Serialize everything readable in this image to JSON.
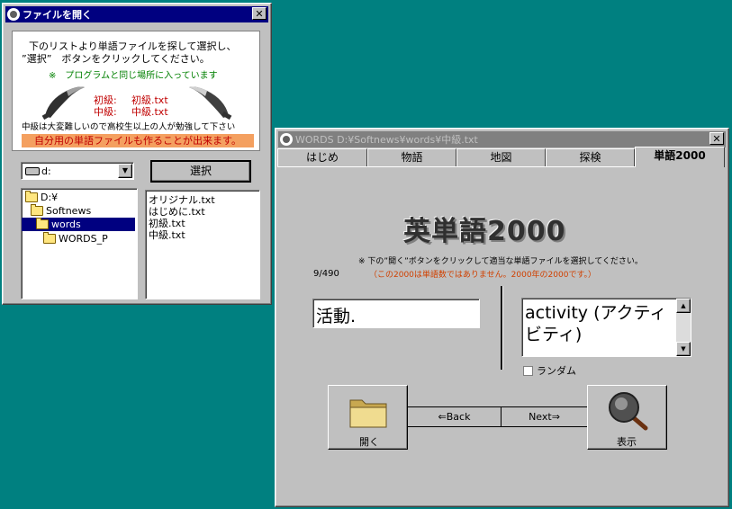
{
  "file_dialog": {
    "title": "ファイルを開く",
    "intro_line1": "下のリストより単語ファイルを探して選択し、",
    "intro_line2": "”選択”　ボタンをクリックしてください。",
    "note": "※　プログラムと同じ場所に入っています",
    "level_beginner_label": "初級:",
    "level_beginner_file": "初級.txt",
    "level_intermediate_label": "中級:",
    "level_intermediate_file": "中級.txt",
    "warning": "中級は大変難しいので高校生以上の人が勉強して下さい",
    "tip": "自分用の単語ファイルも作ることが出来ます。",
    "drive_value": "d:",
    "select_button": "選択",
    "tree": [
      "D:¥",
      "Softnews",
      "words",
      "WORDS_P"
    ],
    "files": [
      "オリジナル.txt",
      "はじめに.txt",
      "初級.txt",
      "中級.txt"
    ]
  },
  "main_window": {
    "title": "WORDS  D:¥Softnews¥words¥中級.txt",
    "tabs": [
      "はじめ",
      "物語",
      "地図",
      "探検",
      "単語2000"
    ],
    "logo": "英単語2000",
    "instruction": "※ 下の”開く”ボタンをクリックして適当な単語ファイルを選択してください。",
    "note": "（この2000は単語数ではありません。2000年の2000です。）",
    "counter": "9/490",
    "japanese_word": "活動.",
    "english_word": "activity (アクティビティ)",
    "random_label": "ランダム",
    "open_label": "開く",
    "back_label": "⇐Back",
    "next_label": "Next⇒",
    "show_label": "表示"
  },
  "colors": {
    "desktop": "#008080",
    "title_active": "#000080",
    "title_inactive": "#808080",
    "red_text": "#c00000",
    "green_text": "#008000",
    "tip_bg": "#f4a060",
    "note_text": "#d04000"
  }
}
